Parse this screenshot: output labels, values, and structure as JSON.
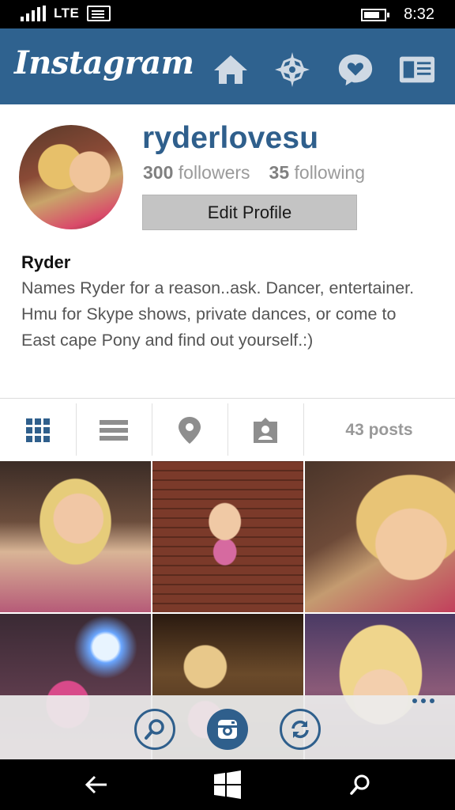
{
  "status_bar": {
    "network": "LTE",
    "time": "8:32"
  },
  "header": {
    "logo": "Instagram",
    "icons": [
      "home-icon",
      "explore-icon",
      "activity-icon",
      "profile-card-icon"
    ],
    "color": "#2f628f"
  },
  "profile": {
    "username": "ryderlovesu",
    "followers_count": "300",
    "followers_label": "followers",
    "following_count": "35",
    "following_label": "following",
    "edit_button": "Edit Profile",
    "name": "Ryder",
    "bio": "Names Ryder for a reason..ask. Dancer, entertainer. Hmu for Skype shows, private dances, or come to East cape Pony and find out yourself.:)"
  },
  "tabs": {
    "icons": [
      "grid-view-icon",
      "list-view-icon",
      "location-pin-icon",
      "tagged-photos-icon"
    ],
    "posts_count": "43 posts"
  },
  "bottom_bar": {
    "buttons": [
      "search-icon",
      "camera-icon",
      "refresh-icon"
    ],
    "more": "..."
  },
  "nav_bar": {
    "buttons": [
      "back-icon",
      "windows-icon",
      "search-icon"
    ]
  },
  "colors": {
    "accent": "#2f5f8c"
  }
}
